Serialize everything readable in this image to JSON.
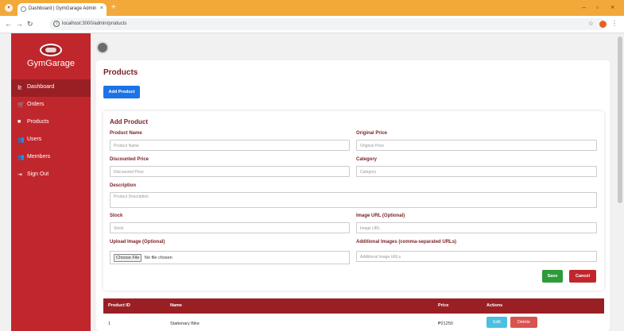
{
  "browser": {
    "tab_title": "Dashboard | GymGarage Admin",
    "url": "localhost:3000/admin/products"
  },
  "sidebar": {
    "brand": "GymGarage",
    "items": [
      {
        "label": "Dashboard",
        "icon": "chart-icon",
        "active": true
      },
      {
        "label": "Orders",
        "icon": "cart-icon",
        "active": false
      },
      {
        "label": "Products",
        "icon": "box-icon",
        "active": false
      },
      {
        "label": "Users",
        "icon": "users-icon",
        "active": false
      },
      {
        "label": "Members",
        "icon": "members-icon",
        "active": false
      },
      {
        "label": "Sign Out",
        "icon": "signout-icon",
        "active": false
      }
    ]
  },
  "main": {
    "title": "Products",
    "add_button": "Add Product"
  },
  "form": {
    "title": "Add Product",
    "product_name": {
      "label": "Product Name",
      "placeholder": "Product Name"
    },
    "original_price": {
      "label": "Original Price",
      "placeholder": "Original Price"
    },
    "discounted_price": {
      "label": "Discounted Price",
      "placeholder": "Discounted Price"
    },
    "category": {
      "label": "Category",
      "placeholder": "Category"
    },
    "description": {
      "label": "Description",
      "placeholder": "Product Description"
    },
    "stock": {
      "label": "Stock",
      "placeholder": "Stock"
    },
    "image_url": {
      "label": "Image URL (Optional)",
      "placeholder": "Image URL"
    },
    "upload_image": {
      "label": "Upload Image (Optional)",
      "button": "Choose File",
      "status": "No file chosen"
    },
    "additional_images": {
      "label": "Additional Images (comma-separated URLs)",
      "placeholder": "Additional Image URLs"
    },
    "save": "Save",
    "cancel": "Cancel"
  },
  "table": {
    "headers": [
      "Product ID",
      "Name",
      "Price",
      "Actions"
    ],
    "rows": [
      {
        "id": "1",
        "name": "Stationary Bike",
        "price": "₱21250",
        "edit": "Edit",
        "delete": "Delete"
      }
    ]
  },
  "colors": {
    "primary": "#c0272d",
    "dark": "#9a1f24",
    "blue": "#1a73e8",
    "green": "#2e9b3a"
  }
}
